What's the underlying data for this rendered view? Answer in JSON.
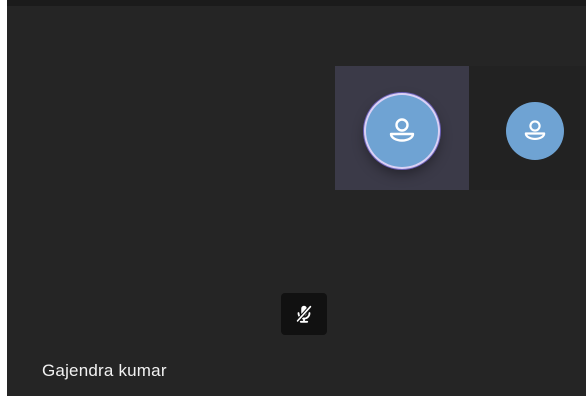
{
  "meeting": {
    "participant_name": "Gajendra kumar"
  },
  "tiles": [
    {
      "state": "active-speaker",
      "avatar_icon": "person-icon"
    },
    {
      "state": "idle",
      "avatar_icon": "person-icon"
    }
  ],
  "controls": {
    "mic_icon": "microphone-muted-icon",
    "mic_muted": true
  },
  "colors": {
    "background": "#252525",
    "active_tile": "#3b3a48",
    "avatar": "#6fa3d3",
    "active_ring": "#d9d0f5"
  }
}
